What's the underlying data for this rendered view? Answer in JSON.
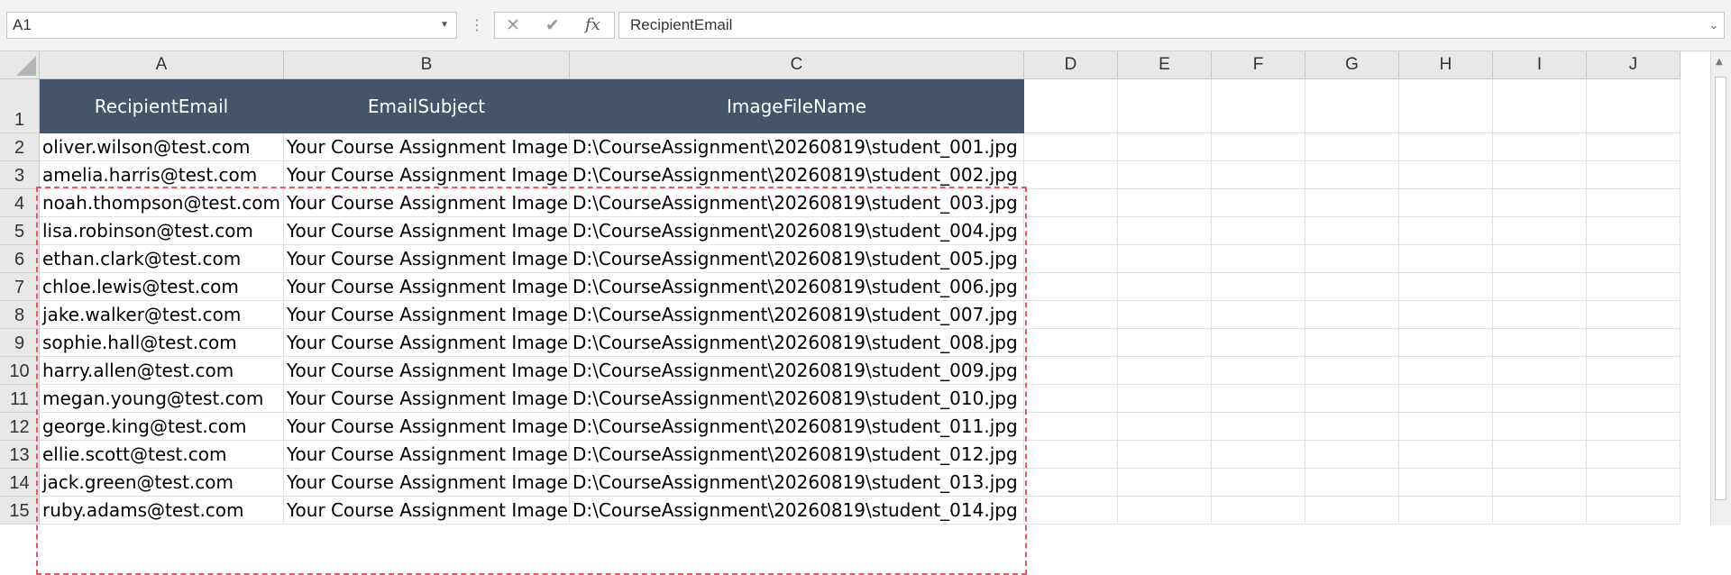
{
  "formula_bar": {
    "name_box": "A1",
    "formula": "RecipientEmail",
    "cancel_icon": "✕",
    "enter_icon": "✔",
    "fx_label": "fx"
  },
  "columns": [
    "A",
    "B",
    "C",
    "D",
    "E",
    "F",
    "G",
    "H",
    "I",
    "J"
  ],
  "table": {
    "headers": [
      "RecipientEmail",
      "EmailSubject",
      "ImageFileName"
    ],
    "rows": [
      [
        "oliver.wilson@test.com",
        "Your Course Assignment Image",
        "D:\\CourseAssignment\\20260819\\student_001.jpg"
      ],
      [
        "amelia.harris@test.com",
        "Your Course Assignment Image",
        "D:\\CourseAssignment\\20260819\\student_002.jpg"
      ],
      [
        "noah.thompson@test.com",
        "Your Course Assignment Image",
        "D:\\CourseAssignment\\20260819\\student_003.jpg"
      ],
      [
        "lisa.robinson@test.com",
        "Your Course Assignment Image",
        "D:\\CourseAssignment\\20260819\\student_004.jpg"
      ],
      [
        "ethan.clark@test.com",
        "Your Course Assignment Image",
        "D:\\CourseAssignment\\20260819\\student_005.jpg"
      ],
      [
        "chloe.lewis@test.com",
        "Your Course Assignment Image",
        "D:\\CourseAssignment\\20260819\\student_006.jpg"
      ],
      [
        "jake.walker@test.com",
        "Your Course Assignment Image",
        "D:\\CourseAssignment\\20260819\\student_007.jpg"
      ],
      [
        "sophie.hall@test.com",
        "Your Course Assignment Image",
        "D:\\CourseAssignment\\20260819\\student_008.jpg"
      ],
      [
        "harry.allen@test.com",
        "Your Course Assignment Image",
        "D:\\CourseAssignment\\20260819\\student_009.jpg"
      ],
      [
        "megan.young@test.com",
        "Your Course Assignment Image",
        "D:\\CourseAssignment\\20260819\\student_010.jpg"
      ],
      [
        "george.king@test.com",
        "Your Course Assignment Image",
        "D:\\CourseAssignment\\20260819\\student_011.jpg"
      ],
      [
        "ellie.scott@test.com",
        "Your Course Assignment Image",
        "D:\\CourseAssignment\\20260819\\student_012.jpg"
      ],
      [
        "jack.green@test.com",
        "Your Course Assignment Image",
        "D:\\CourseAssignment\\20260819\\student_013.jpg"
      ],
      [
        "ruby.adams@test.com",
        "Your Course Assignment Image",
        "D:\\CourseAssignment\\20260819\\student_014.jpg"
      ]
    ]
  },
  "colors": {
    "header_fill": "#44546a",
    "header_text": "#ffffff",
    "selection_border": "#e05a6a"
  }
}
